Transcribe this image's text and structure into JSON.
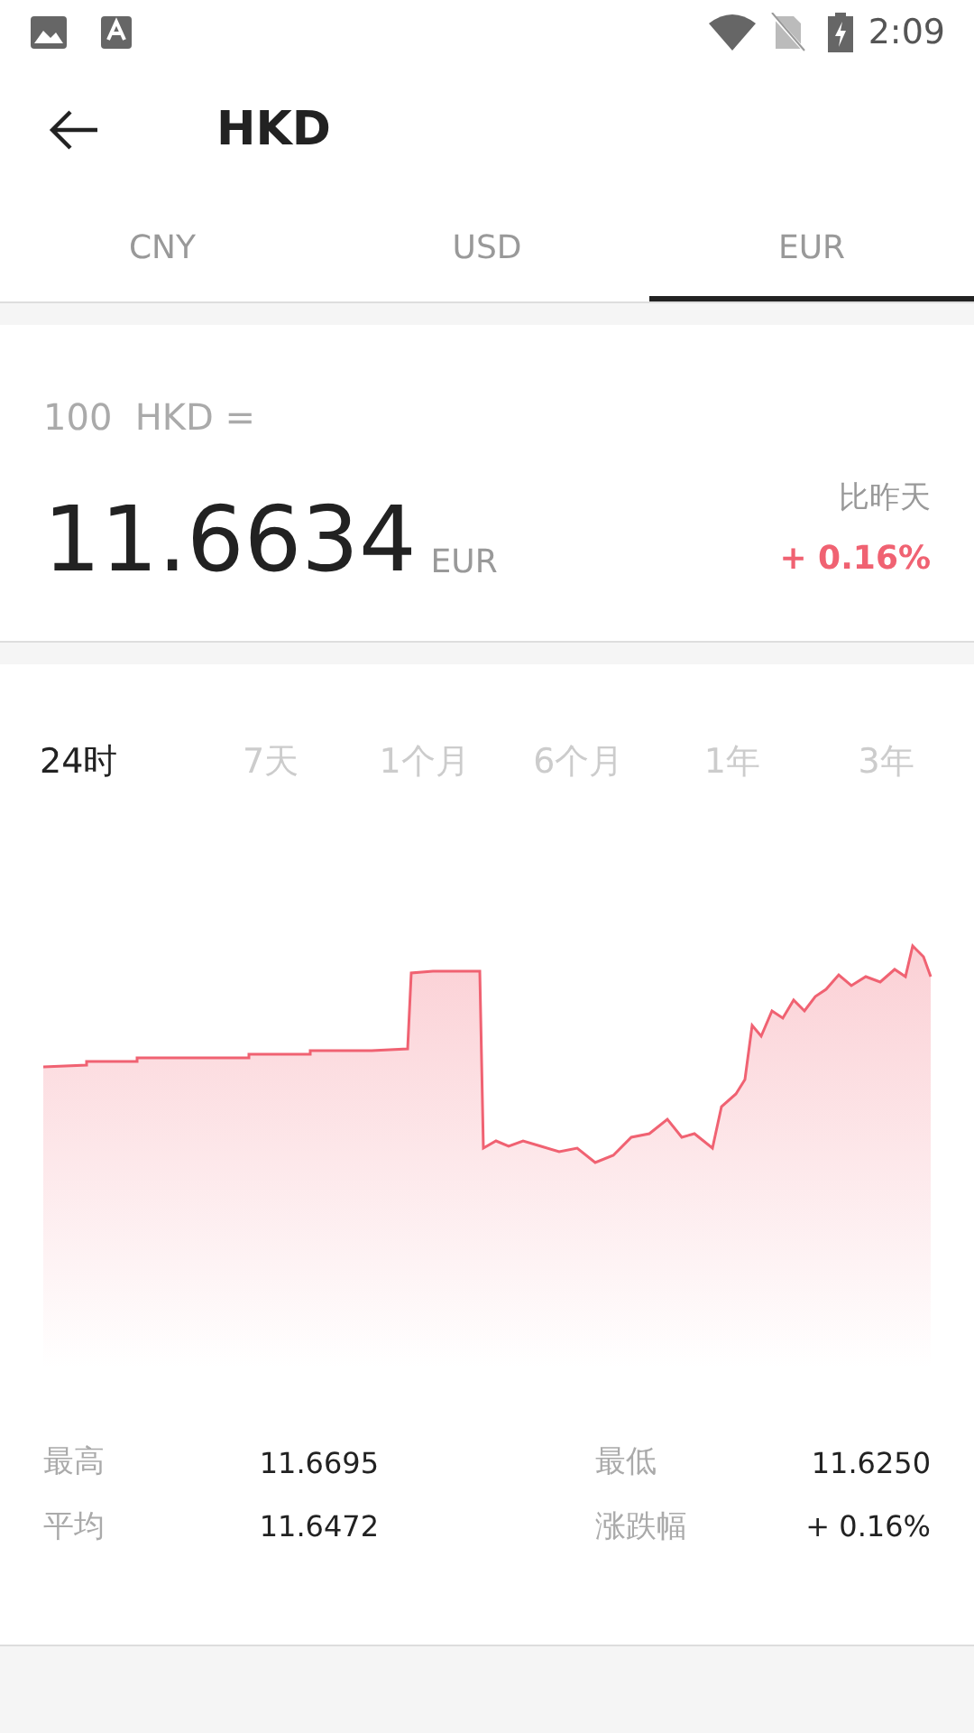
{
  "status_bar": {
    "time": "2:09"
  },
  "app_bar": {
    "title": "HKD"
  },
  "tabs": [
    {
      "label": "CNY",
      "selected": false
    },
    {
      "label": "USD",
      "selected": false
    },
    {
      "label": "EUR",
      "selected": true
    }
  ],
  "rate": {
    "base": "100  HKD =",
    "value": "11.6634",
    "unit": "EUR",
    "change_label": "比昨天",
    "change": "+ 0.16%"
  },
  "ranges": [
    {
      "label": "24时",
      "selected": true
    },
    {
      "label": "7天",
      "selected": false
    },
    {
      "label": "1个月",
      "selected": false
    },
    {
      "label": "6个月",
      "selected": false
    },
    {
      "label": "1年",
      "selected": false
    },
    {
      "label": "3年",
      "selected": false
    }
  ],
  "stats": [
    {
      "label": "最高",
      "value": "11.6695"
    },
    {
      "label": "最低",
      "value": "11.6250"
    },
    {
      "label": "平均",
      "value": "11.6472"
    },
    {
      "label": "涨跌幅",
      "value": "+ 0.16%"
    }
  ]
}
